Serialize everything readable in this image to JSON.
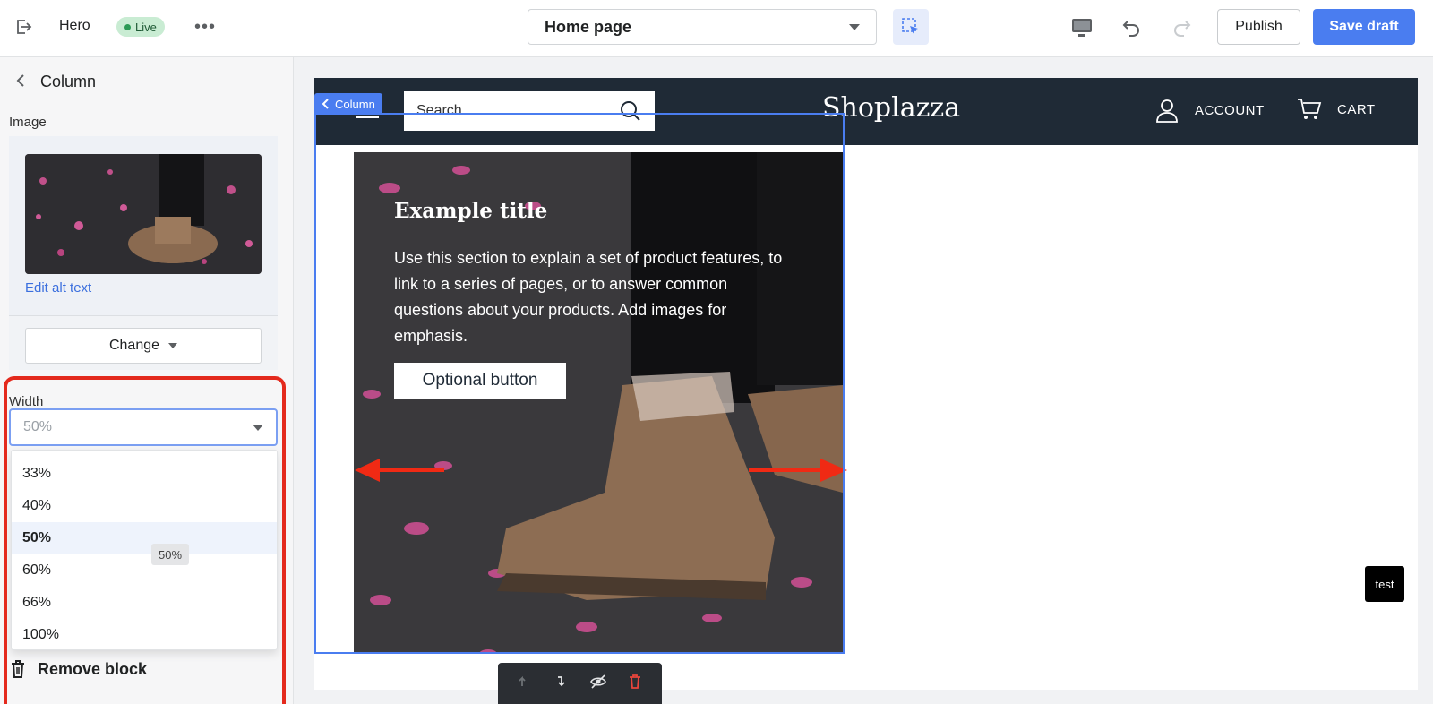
{
  "topbar": {
    "section_name": "Hero",
    "status_badge": "Live",
    "page_selector": "Home page",
    "publish_label": "Publish",
    "save_label": "Save draft",
    "accent_color": "#4a7df0"
  },
  "sidebar": {
    "title": "Column",
    "image_label": "Image",
    "edit_alt_label": "Edit alt text",
    "change_label": "Change",
    "width_label": "Width",
    "width_value": "50%",
    "width_options": [
      "33%",
      "40%",
      "50%",
      "60%",
      "66%",
      "100%"
    ],
    "selected_option": "50%",
    "tooltip": "50%",
    "remove_label": "Remove block",
    "highlight_color": "#e42a1d"
  },
  "canvas": {
    "column_tag": "Column",
    "search_placeholder": "Search...",
    "logo": "Shoplazza",
    "account_label": "ACCOUNT",
    "cart_label": "CART",
    "hero_title": "Example title",
    "hero_text": "Use this section to explain a set of product features, to link to a series of pages, or to answer common questions about your products. Add images for emphasis.",
    "hero_button": "Optional button",
    "test_badge": "test"
  }
}
